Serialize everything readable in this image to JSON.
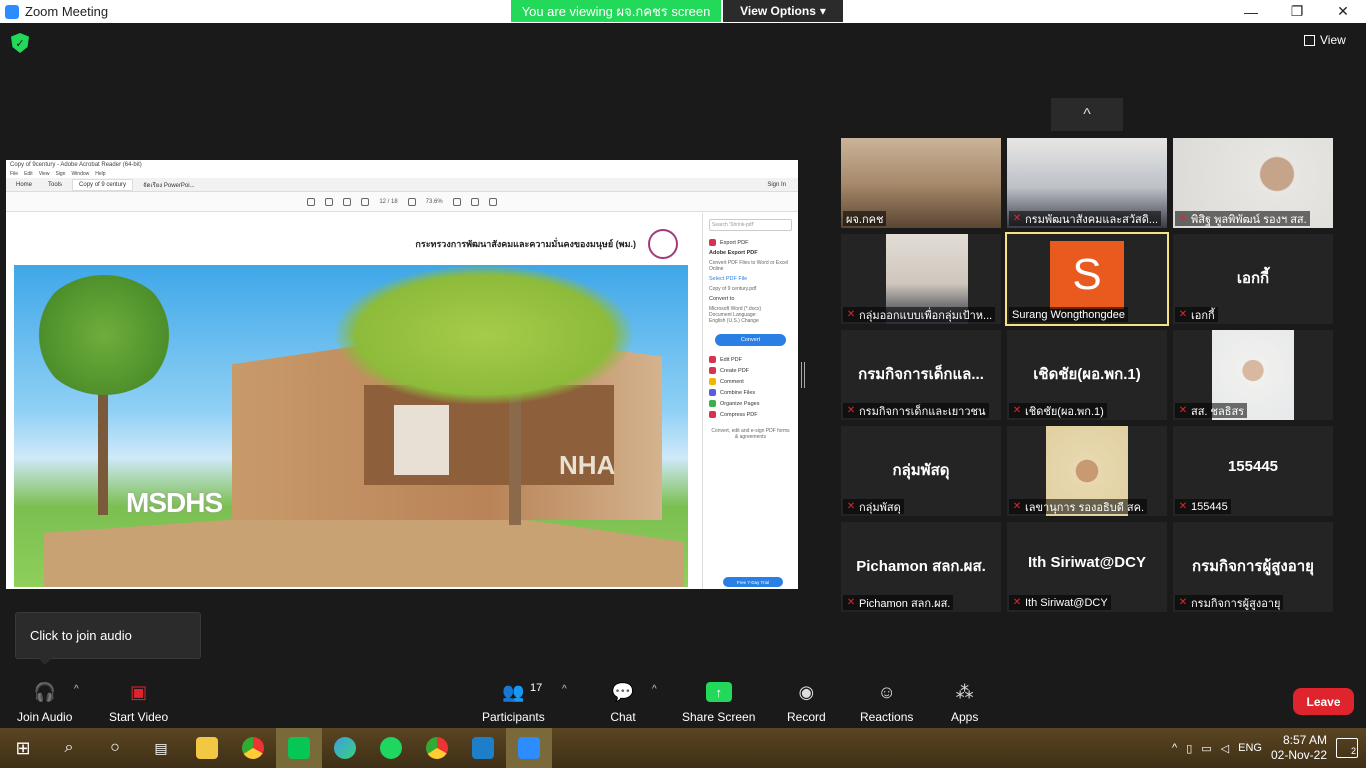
{
  "window": {
    "title": "Zoom Meeting",
    "minimize": "—",
    "maximize": "❐",
    "close": "✕"
  },
  "banner": {
    "text": "You are viewing ผจ.กคชร screen",
    "view_options": "View Options",
    "view_options_caret": "▾"
  },
  "top_right": {
    "view_label": "View"
  },
  "shared_screen": {
    "window_title": "Copy of 9century - Adobe Acrobat Reader (64-bit)",
    "menu": [
      "File",
      "Edit",
      "View",
      "Sign",
      "Window",
      "Help"
    ],
    "tabs": [
      "Home",
      "Tools",
      "Copy of 9 century",
      "จัดเรียง PowerPoi..."
    ],
    "sign_in": "Sign In",
    "page_indicator": "12 / 18",
    "zoom": "73.6%",
    "doc_header": "กระทรวงการพัฒนาสังคมและความมั่นคงของมนุษย์ (พม.)",
    "render_text_left": "MSDHS",
    "render_text_right": "NHA",
    "side": {
      "search": "Search 'Shrink-pdf'",
      "export_pdf": "Export PDF",
      "adobe_export": "Adobe Export PDF",
      "export_desc": "Convert PDF Files to Word or Excel Online",
      "select_file": "Select PDF File",
      "file_name": "Copy of 9 century.pdf",
      "convert_to": "Convert to",
      "format": "Microsoft Word (*.docx)",
      "doc_lang": "Document Language:",
      "lang": "English (U.S.) Change",
      "convert_btn": "Convert",
      "tools": [
        "Edit PDF",
        "Create PDF",
        "Comment",
        "Combine Files",
        "Organize Pages",
        "Compress PDF"
      ],
      "promo": "Convert, edit and e-sign PDF forms & agreements",
      "trial": "Free 7-Day Trial"
    }
  },
  "gallery": {
    "scroll_up": "^",
    "tiles": [
      {
        "kind": "video",
        "name": "ผจ.กคช"
      },
      {
        "kind": "video",
        "name": "กรมพัฒนาสังคมและสวัสดิ...",
        "muted": true
      },
      {
        "kind": "video",
        "name": "พิสิฐ พูลพิพัฒน์ รองฯ สส.",
        "muted": true
      },
      {
        "kind": "video",
        "name": "กลุ่มออกแบบเพื่อกลุ่มเป้าห...",
        "muted": true
      },
      {
        "kind": "avatar",
        "initial": "S",
        "name": "Surang Wongthongdee",
        "active": true
      },
      {
        "kind": "text",
        "display": "เอกกี้",
        "name": "เอกกี้",
        "muted": true
      },
      {
        "kind": "text",
        "display": "กรมกิจการเด็กแล...",
        "name": "กรมกิจการเด็กและเยาวชน",
        "muted": true
      },
      {
        "kind": "text",
        "display": "เชิดชัย(ผอ.พก.1)",
        "name": "เชิดชัย(ผอ.พก.1)",
        "muted": true
      },
      {
        "kind": "video",
        "name": "สส. ชลธิสร",
        "muted": true
      },
      {
        "kind": "text",
        "display": "กลุ่มพัสดุ",
        "name": "กลุ่มพัสดุ",
        "muted": true
      },
      {
        "kind": "video",
        "name": "เลขานุการ รองอธิบดี สค.",
        "muted": true
      },
      {
        "kind": "text",
        "display": "155445",
        "name": "155445",
        "muted": true
      },
      {
        "kind": "text",
        "display": "Pichamon สลก.ผส.",
        "name": "Pichamon สลก.ผส.",
        "muted": true
      },
      {
        "kind": "text",
        "display": "Ith Siriwat@DCY",
        "name": "Ith Siriwat@DCY",
        "muted": true
      },
      {
        "kind": "text",
        "display": "กรมกิจการผู้สูงอายุ",
        "name": "กรมกิจการผู้สูงอายุ",
        "muted": true
      }
    ]
  },
  "tooltip": {
    "text": "Click to join audio"
  },
  "toolbar": {
    "join_audio": "Join Audio",
    "start_video": "Start Video",
    "participants": "Participants",
    "participants_count": "17",
    "chat": "Chat",
    "share_screen": "Share Screen",
    "record": "Record",
    "reactions": "Reactions",
    "apps": "Apps",
    "leave": "Leave",
    "caret": "^"
  },
  "taskbar": {
    "lang": "ENG",
    "time": "8:57 AM",
    "date": "02-Nov-22",
    "notifications": "2"
  },
  "colors": {
    "accent_green": "#23d959",
    "leave_red": "#e0242d",
    "active_border": "#f4e283",
    "avatar_orange": "#e85a1e"
  }
}
